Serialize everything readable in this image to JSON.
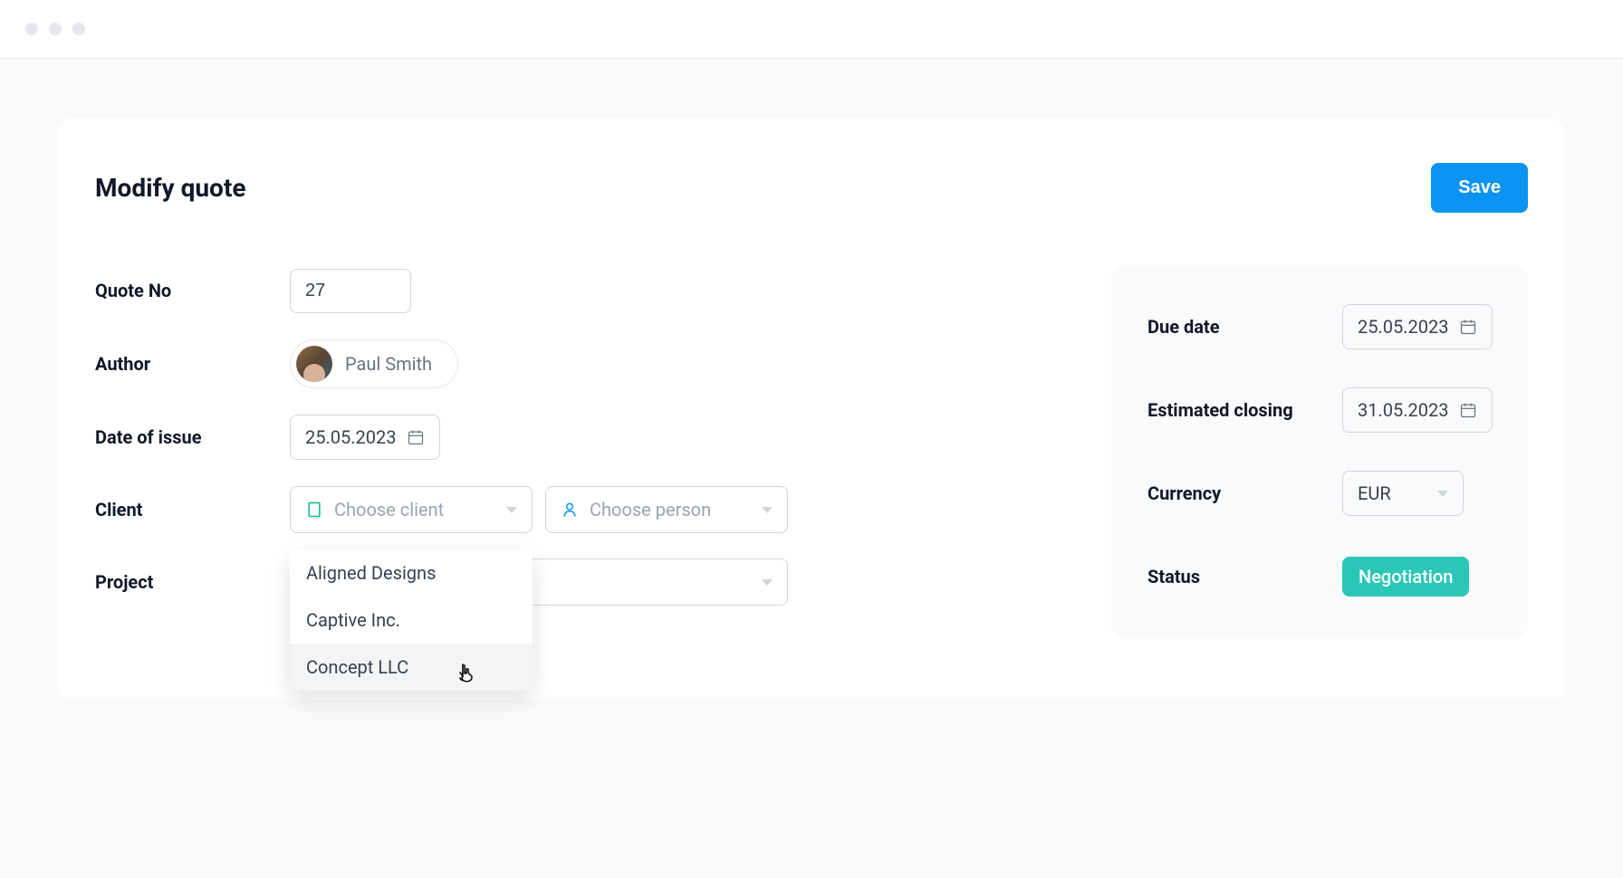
{
  "header": {
    "title": "Modify quote",
    "save_label": "Save"
  },
  "form": {
    "quote_no_label": "Quote No",
    "quote_no_value": "27",
    "author_label": "Author",
    "author_name": "Paul Smith",
    "date_of_issue_label": "Date of issue",
    "date_of_issue_value": "25.05.2023",
    "client_label": "Client",
    "client_placeholder": "Choose client",
    "person_placeholder": "Choose person",
    "project_label": "Project",
    "client_options": [
      "Aligned Designs",
      "Captive Inc.",
      "Concept LLC"
    ]
  },
  "sidebar": {
    "due_date_label": "Due date",
    "due_date_value": "25.05.2023",
    "estimated_closing_label": "Estimated closing",
    "estimated_closing_value": "31.05.2023",
    "currency_label": "Currency",
    "currency_value": "EUR",
    "status_label": "Status",
    "status_value": "Negotiation"
  }
}
